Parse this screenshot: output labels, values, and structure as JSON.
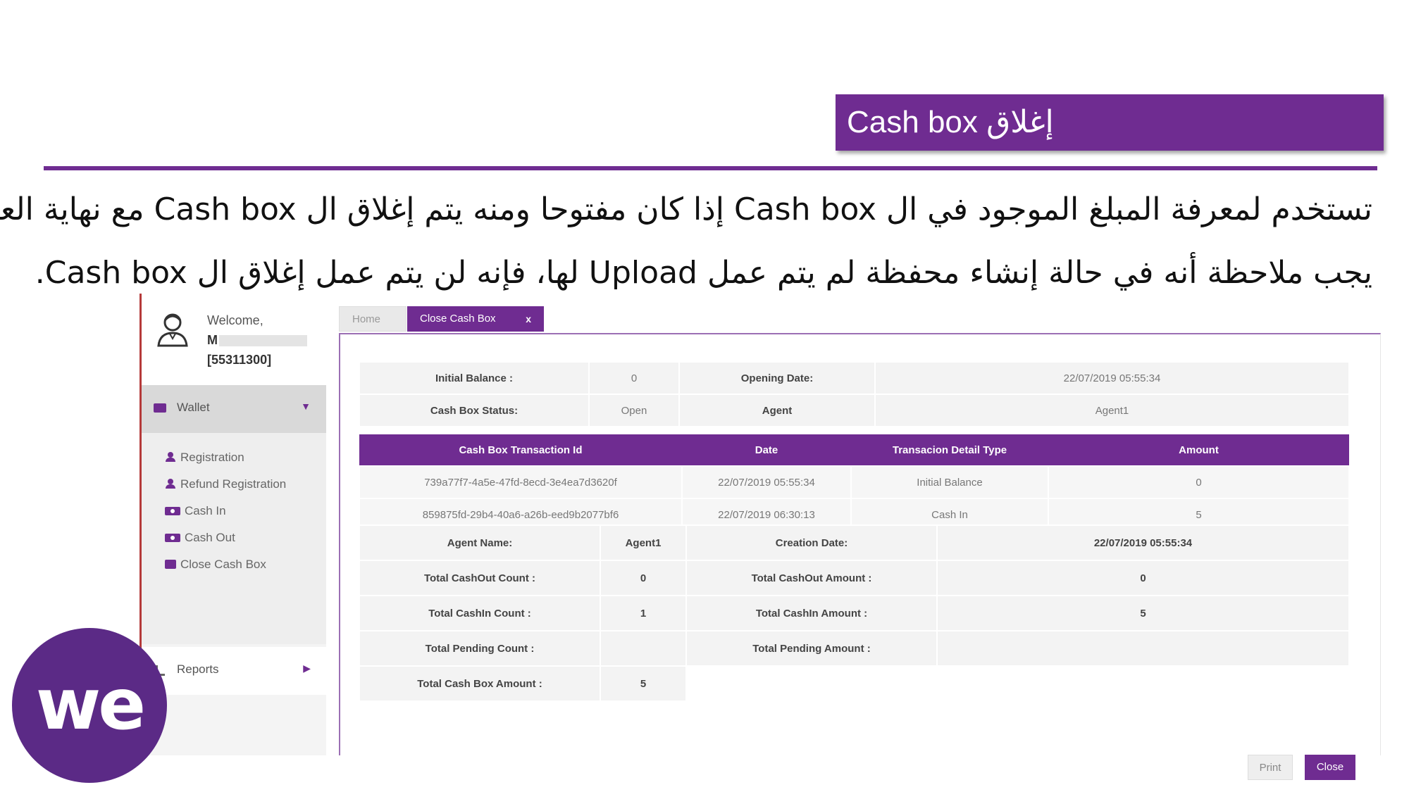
{
  "slide": {
    "title": "إغلاق Cash box",
    "line1": "تستخدم لمعرفة المبلغ الموجود في ال Cash box إذا كان مفتوحا ومنه يتم إغلاق ال Cash box مع نهاية العمل",
    "line2": "يجب ملاحظة أنه في حالة إنشاء محفظة لم يتم عمل Upload لها، فإنه لن يتم عمل إغلاق ال Cash box."
  },
  "colors": {
    "brand": "#6f2c91"
  },
  "user": {
    "welcome": "Welcome,",
    "name": "M",
    "id": "[55311300]"
  },
  "sidebar": {
    "wallet_label": "Wallet",
    "items": [
      {
        "label": "Registration",
        "icon": "user-icon"
      },
      {
        "label": "Refund Registration",
        "icon": "user-icon"
      },
      {
        "label": "Cash In",
        "icon": "money-icon"
      },
      {
        "label": "Cash Out",
        "icon": "money-icon"
      },
      {
        "label": "Close Cash Box",
        "icon": "cashbox-icon"
      }
    ],
    "reports_label": "Reports"
  },
  "tabs": {
    "home": "Home",
    "active": "Close Cash Box",
    "close_x": "x"
  },
  "info": {
    "initial_balance_label": "Initial Balance :",
    "initial_balance": "0",
    "opening_date_label": "Opening Date:",
    "opening_date": "22/07/2019 05:55:34",
    "status_label": "Cash Box Status:",
    "status": "Open",
    "agent_label": "Agent",
    "agent": "Agent1"
  },
  "transactions": {
    "headers": [
      "Cash Box Transaction Id",
      "Date",
      "Transacion Detail Type",
      "Amount"
    ],
    "rows": [
      [
        "739a77f7-4a5e-47fd-8ecd-3e4ea7d3620f",
        "22/07/2019 05:55:34",
        "Initial Balance",
        "0"
      ],
      [
        "859875fd-29b4-40a6-a26b-eed9b2077bf6",
        "22/07/2019 06:30:13",
        "Cash In",
        "5"
      ]
    ]
  },
  "summary": {
    "agent_name_label": "Agent Name:",
    "agent_name": "Agent1",
    "creation_date_label": "Creation Date:",
    "creation_date": "22/07/2019 05:55:34",
    "cashout_count_label": "Total CashOut Count :",
    "cashout_count": "0",
    "cashout_amount_label": "Total CashOut Amount :",
    "cashout_amount": "0",
    "cashin_count_label": "Total CashIn Count :",
    "cashin_count": "1",
    "cashin_amount_label": "Total CashIn Amount :",
    "cashin_amount": "5",
    "pending_count_label": "Total Pending Count :",
    "pending_count": "",
    "pending_amount_label": "Total Pending Amount :",
    "pending_amount": "",
    "total_label": "Total Cash Box Amount :",
    "total": "5"
  },
  "buttons": {
    "print": "Print",
    "close": "Close"
  },
  "logo": {
    "text": "we"
  }
}
